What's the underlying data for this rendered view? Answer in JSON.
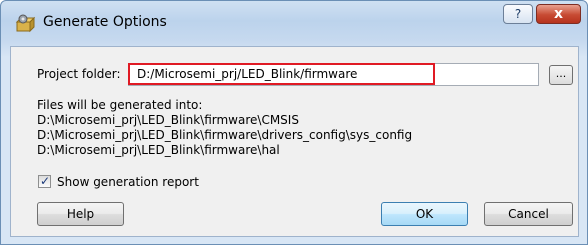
{
  "window": {
    "title": "Generate Options"
  },
  "titlebar_buttons": {
    "help_label": "?",
    "close_label": "x"
  },
  "project_folder": {
    "label": "Project folder:",
    "value": "D:/Microsemi_prj/LED_Blink/firmware",
    "browse_label": "..."
  },
  "files_info": {
    "heading": "Files will be generated into:",
    "paths": [
      "D:\\Microsemi_prj\\LED_Blink\\firmware\\CMSIS",
      "D:\\Microsemi_prj\\LED_Blink\\firmware\\drivers_config\\sys_config",
      "D:\\Microsemi_prj\\LED_Blink\\firmware\\hal"
    ]
  },
  "show_report": {
    "label": "Show generation report",
    "checked": true
  },
  "buttons": {
    "help": "Help",
    "ok": "OK",
    "cancel": "Cancel"
  },
  "colors": {
    "highlight": "#e01a24",
    "title_bar": "#c6d9ef",
    "close_button": "#c74b33"
  },
  "icons": {
    "app": "gear-box-icon"
  }
}
